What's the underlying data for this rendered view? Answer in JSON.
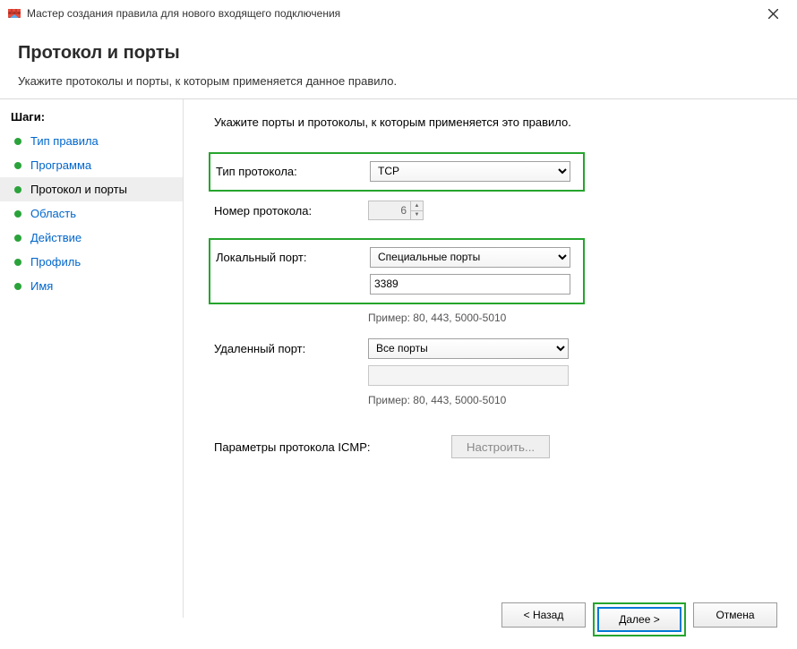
{
  "window": {
    "title": "Мастер создания правила для нового входящего подключения"
  },
  "header": {
    "title": "Протокол и порты",
    "subtitle": "Укажите протоколы и порты, к которым применяется данное правило."
  },
  "sidebar": {
    "title": "Шаги:",
    "items": [
      {
        "label": "Тип правила",
        "state": "completed"
      },
      {
        "label": "Программа",
        "state": "completed"
      },
      {
        "label": "Протокол и порты",
        "state": "current"
      },
      {
        "label": "Область",
        "state": "pending"
      },
      {
        "label": "Действие",
        "state": "pending"
      },
      {
        "label": "Профиль",
        "state": "pending"
      },
      {
        "label": "Имя",
        "state": "pending"
      }
    ]
  },
  "main": {
    "instruction": "Укажите порты и протоколы, к которым применяется это правило.",
    "protocol_type_label": "Тип протокола:",
    "protocol_type_value": "TCP",
    "protocol_number_label": "Номер протокола:",
    "protocol_number_value": "6",
    "local_port_label": "Локальный порт:",
    "local_port_mode": "Специальные порты",
    "local_port_value": "3389",
    "local_port_hint": "Пример: 80, 443, 5000-5010",
    "remote_port_label": "Удаленный порт:",
    "remote_port_mode": "Все порты",
    "remote_port_value": "",
    "remote_port_hint": "Пример: 80, 443, 5000-5010",
    "icmp_label": "Параметры протокола ICMP:",
    "icmp_button": "Настроить..."
  },
  "footer": {
    "back": "< Назад",
    "next": "Далее >",
    "cancel": "Отмена"
  },
  "highlight_color": "#25a52d"
}
